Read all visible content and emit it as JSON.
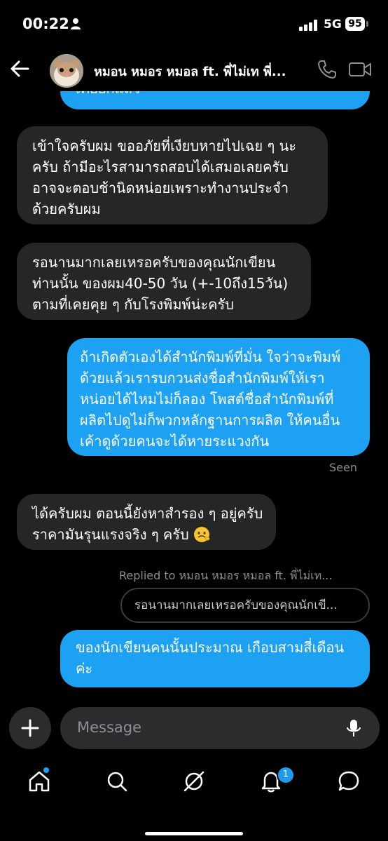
{
  "status": {
    "time": "00:22",
    "network": "5G",
    "battery": "95"
  },
  "header": {
    "contact_name": "หมอน หมอร หมอล ft. พี่ไม่เท พี่..."
  },
  "messages": [
    {
      "direction": "out",
      "lines": [
        "เคยยกแล้ว"
      ]
    },
    {
      "direction": "in",
      "lines": [
        "เข้าใจครับผม ขออภัยที่เงียบหายไปเฉย ๆ นะ",
        "ครับ ถ้ามีอะไรสามารถสอบได้เสมอเลยครับ",
        "อาจจะตอบช้านิดหน่อยเพราะทำงานประจำ",
        "ด้วยครับผม"
      ]
    },
    {
      "direction": "in",
      "lines": [
        "รอนานมากเลยเหรอครับของคุณนักเขียน",
        "ท่านนั้น ของผม40-50 วัน (+-10ถึง15วัน)",
        "ตามที่เคยคุย ๆ กับโรงพิมพ์น่ะครับ"
      ]
    },
    {
      "direction": "out",
      "lines": [
        "ถ้าเกิดตัวเองได้สำนักพิมพ์ที่มั่น ใจว่าจะพิมพ์",
        "ด้วยแล้วเรารบกวนส่งชื่อสำนักพิมพ์ให้เรา",
        "หน่อยได้ไหมไม่ก็ลอง โพสต์ชื่อสำนักพิมพ์ที่",
        "ผลิตไปดูไม่ก็พวกหลักฐานการผลิต ให้คนอื่น",
        "เค้าดูด้วยคนจะได้หายระแวงกัน"
      ]
    },
    {
      "direction": "in",
      "lines": [
        "ได้ครับผม ตอนนี้ยังหาสำรอง ๆ อยู่ครับ",
        "ราคามันรุนแรงจริง ๆ ครับ"
      ]
    },
    {
      "direction": "out",
      "lines": [
        "ของนักเขียนคนนั้นประมาณ เกือบสามสี่เดือน",
        "ค่ะ"
      ]
    }
  ],
  "seen_label": "Seen",
  "reply": {
    "replied_label": "Replied to หมอน หมอร หมอล ft. พี่ไม่เท...",
    "preview": "รอนานมากเลยเหรอครับของคุณนักเขี..."
  },
  "composer": {
    "placeholder": "Message"
  },
  "nav": {
    "notification_count": "1"
  },
  "colors": {
    "outgoing_bubble": "#1da1f2",
    "incoming_bubble": "#262628",
    "background": "#000000"
  }
}
